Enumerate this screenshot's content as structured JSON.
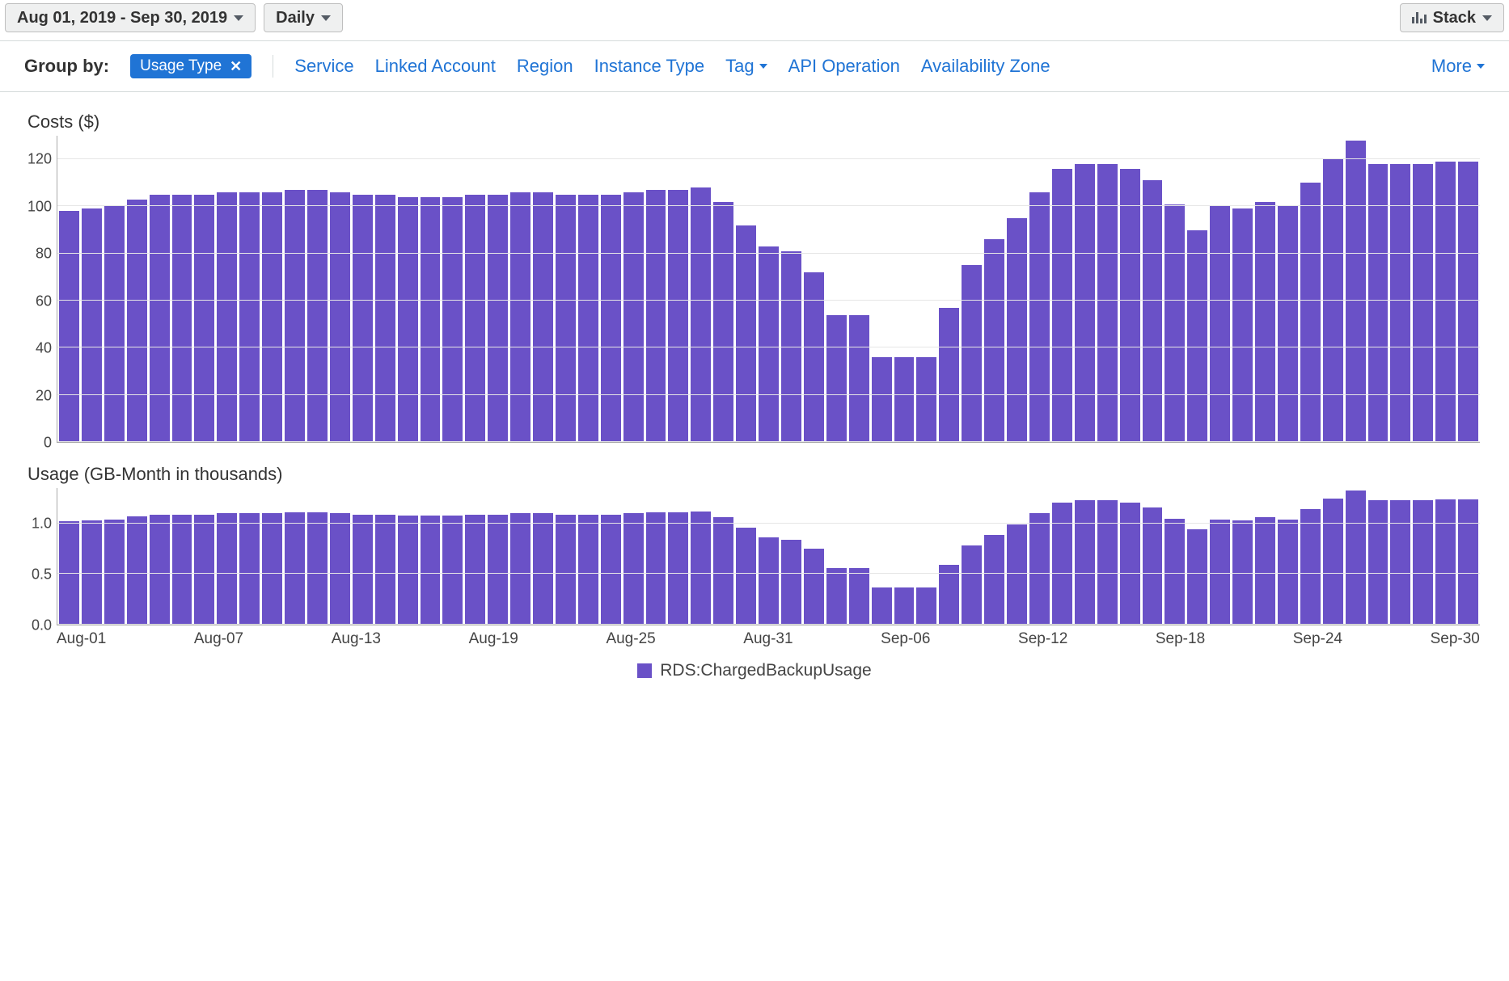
{
  "toolbar": {
    "date_range": "Aug 01, 2019 - Sep 30, 2019",
    "granularity": "Daily",
    "view_mode": "Stack"
  },
  "groupby": {
    "label": "Group by:",
    "active": {
      "label": "Usage Type",
      "close": "✕"
    },
    "options": [
      "Service",
      "Linked Account",
      "Region",
      "Instance Type",
      "Tag",
      "API Operation",
      "Availability Zone"
    ],
    "more": "More"
  },
  "legend": {
    "series": "RDS:ChargedBackupUsage"
  },
  "x_ticks": [
    "Aug-01",
    "Aug-07",
    "Aug-13",
    "Aug-19",
    "Aug-25",
    "Aug-31",
    "Sep-06",
    "Sep-12",
    "Sep-18",
    "Sep-24",
    "Sep-30"
  ],
  "costs": {
    "title": "Costs ($)",
    "y_ticks": [
      "0",
      "20",
      "40",
      "60",
      "80",
      "100",
      "120"
    ]
  },
  "usage": {
    "title": "Usage (GB-Month in thousands)",
    "y_ticks": [
      "0.0",
      "0.5",
      "1.0"
    ]
  },
  "chart_data": [
    {
      "type": "bar",
      "title": "Costs ($)",
      "xlabel": "",
      "ylabel": "Costs ($)",
      "ylim": [
        0,
        130
      ],
      "categories": [
        "Aug-01",
        "Aug-02",
        "Aug-03",
        "Aug-04",
        "Aug-05",
        "Aug-06",
        "Aug-07",
        "Aug-08",
        "Aug-09",
        "Aug-10",
        "Aug-11",
        "Aug-12",
        "Aug-13",
        "Aug-14",
        "Aug-15",
        "Aug-16",
        "Aug-17",
        "Aug-18",
        "Aug-19",
        "Aug-20",
        "Aug-21",
        "Aug-22",
        "Aug-23",
        "Aug-24",
        "Aug-25",
        "Aug-26",
        "Aug-27",
        "Aug-28",
        "Aug-29",
        "Aug-30",
        "Aug-31",
        "Sep-01",
        "Sep-02",
        "Sep-03",
        "Sep-04",
        "Sep-05",
        "Sep-06",
        "Sep-07",
        "Sep-08",
        "Sep-09",
        "Sep-10",
        "Sep-11",
        "Sep-12",
        "Sep-13",
        "Sep-14",
        "Sep-15",
        "Sep-16",
        "Sep-17",
        "Sep-18",
        "Sep-19",
        "Sep-20",
        "Sep-21",
        "Sep-22",
        "Sep-23",
        "Sep-24",
        "Sep-25",
        "Sep-26",
        "Sep-27",
        "Sep-28",
        "Sep-29",
        "Sep-30"
      ],
      "series": [
        {
          "name": "RDS:ChargedBackupUsage",
          "values": [
            98,
            99,
            100,
            103,
            105,
            105,
            105,
            106,
            106,
            106,
            107,
            107,
            106,
            105,
            105,
            104,
            104,
            104,
            105,
            105,
            106,
            106,
            105,
            105,
            105,
            106,
            107,
            107,
            108,
            102,
            92,
            83,
            81,
            72,
            54,
            54,
            36,
            36,
            36,
            57,
            75,
            86,
            95,
            106,
            116,
            118,
            118,
            116,
            111,
            101,
            90,
            100,
            99,
            102,
            100,
            110,
            120,
            128,
            118,
            118,
            118,
            119,
            119
          ]
        }
      ]
    },
    {
      "type": "bar",
      "title": "Usage (GB-Month in thousands)",
      "xlabel": "",
      "ylabel": "GB-Month (thousands)",
      "ylim": [
        0,
        1.35
      ],
      "categories": [
        "Aug-01",
        "Aug-02",
        "Aug-03",
        "Aug-04",
        "Aug-05",
        "Aug-06",
        "Aug-07",
        "Aug-08",
        "Aug-09",
        "Aug-10",
        "Aug-11",
        "Aug-12",
        "Aug-13",
        "Aug-14",
        "Aug-15",
        "Aug-16",
        "Aug-17",
        "Aug-18",
        "Aug-19",
        "Aug-20",
        "Aug-21",
        "Aug-22",
        "Aug-23",
        "Aug-24",
        "Aug-25",
        "Aug-26",
        "Aug-27",
        "Aug-28",
        "Aug-29",
        "Aug-30",
        "Aug-31",
        "Sep-01",
        "Sep-02",
        "Sep-03",
        "Sep-04",
        "Sep-05",
        "Sep-06",
        "Sep-07",
        "Sep-08",
        "Sep-09",
        "Sep-10",
        "Sep-11",
        "Sep-12",
        "Sep-13",
        "Sep-14",
        "Sep-15",
        "Sep-16",
        "Sep-17",
        "Sep-18",
        "Sep-19",
        "Sep-20",
        "Sep-21",
        "Sep-22",
        "Sep-23",
        "Sep-24",
        "Sep-25",
        "Sep-26",
        "Sep-27",
        "Sep-28",
        "Sep-29",
        "Sep-30"
      ],
      "series": [
        {
          "name": "RDS:ChargedBackupUsage",
          "values": [
            1.02,
            1.03,
            1.04,
            1.07,
            1.09,
            1.09,
            1.09,
            1.1,
            1.1,
            1.1,
            1.11,
            1.11,
            1.1,
            1.09,
            1.09,
            1.08,
            1.08,
            1.08,
            1.09,
            1.09,
            1.1,
            1.1,
            1.09,
            1.09,
            1.09,
            1.1,
            1.11,
            1.11,
            1.12,
            1.06,
            0.96,
            0.86,
            0.84,
            0.75,
            0.56,
            0.56,
            0.37,
            0.37,
            0.37,
            0.59,
            0.78,
            0.89,
            0.99,
            1.1,
            1.21,
            1.23,
            1.23,
            1.21,
            1.16,
            1.05,
            0.94,
            1.04,
            1.03,
            1.06,
            1.04,
            1.14,
            1.25,
            1.33,
            1.23,
            1.23,
            1.23,
            1.24,
            1.24
          ]
        }
      ]
    }
  ]
}
